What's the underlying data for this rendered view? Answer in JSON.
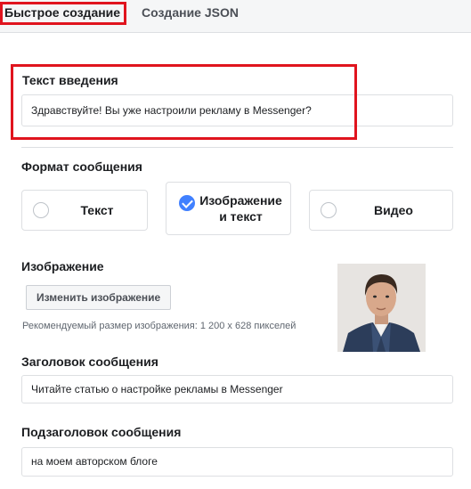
{
  "tabs": [
    {
      "label": "Быстрое создание",
      "active": true
    },
    {
      "label": "Создание JSON",
      "active": false
    }
  ],
  "intro": {
    "label": "Текст введения",
    "value": "Здравствуйте! Вы уже настроили рекламу в Messenger?"
  },
  "format": {
    "label": "Формат сообщения",
    "options": [
      {
        "label_line1": "Текст",
        "label_line2": "",
        "selected": false
      },
      {
        "label_line1": "Изображение",
        "label_line2": "и текст",
        "selected": true
      },
      {
        "label_line1": "Видео",
        "label_line2": "",
        "selected": false
      }
    ]
  },
  "image": {
    "label": "Изображение",
    "change_button": "Изменить изображение",
    "hint": "Рекомендуемый размер изображения: 1 200 x 628 пикселей"
  },
  "headline": {
    "label": "Заголовок сообщения",
    "value": "Читайте статью о настройке рекламы в Messenger"
  },
  "subheadline": {
    "label": "Подзаголовок сообщения",
    "value": "на моем авторском блоге"
  },
  "colors": {
    "accent": "#4080ff",
    "highlight": "#e0141e",
    "border": "#dddfe2"
  }
}
